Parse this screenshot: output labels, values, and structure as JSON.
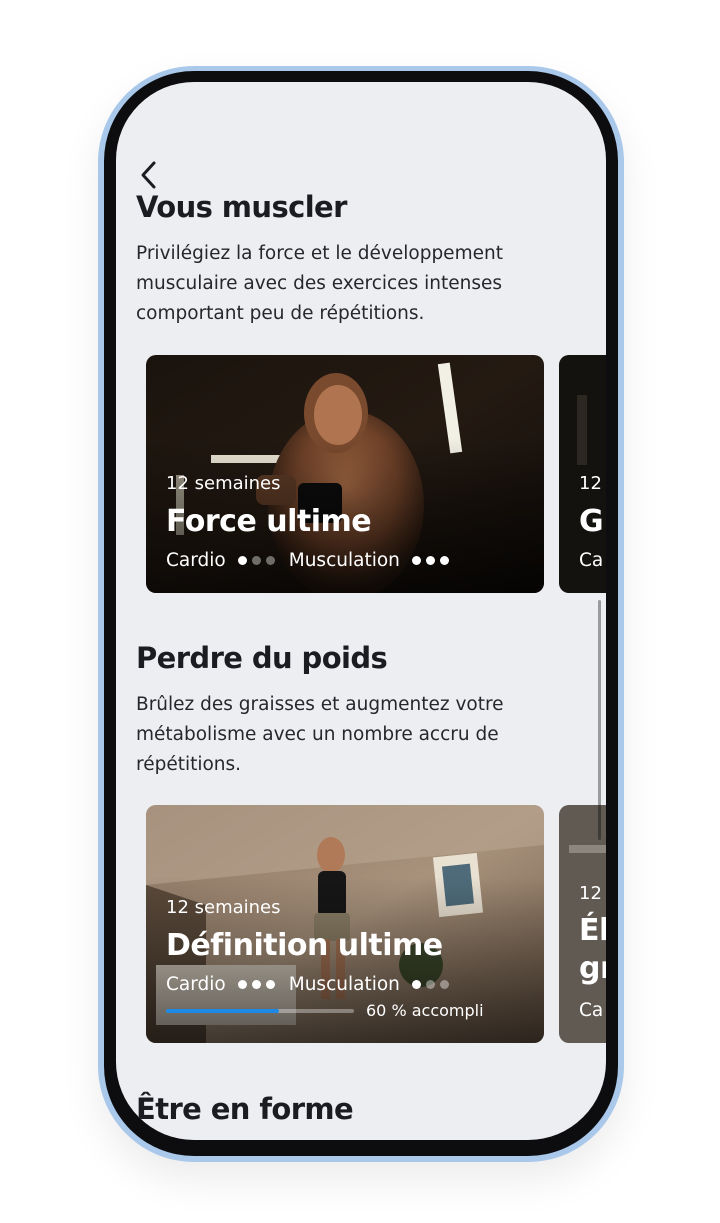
{
  "header": {
    "back_label": "Retour"
  },
  "sections": [
    {
      "title": "Vous muscler",
      "description": "Privilégiez la force et le développement musculaire avec des exercices intenses comportant peu de répétitions.",
      "cards": [
        {
          "duration": "12 semaines",
          "title": "Force ultime",
          "cardio_label": "Cardio",
          "cardio_level": 1,
          "strength_label": "Musculation",
          "strength_level": 3
        },
        {
          "duration": "12",
          "title": "G",
          "cardio_label": "Ca"
        }
      ]
    },
    {
      "title": "Perdre du poids",
      "description": "Brûlez des graisses et augmentez votre métabolisme avec un nombre accru de répétitions.",
      "cards": [
        {
          "duration": "12 semaines",
          "title": "Définition ultime",
          "cardio_label": "Cardio",
          "cardio_level": 3,
          "strength_label": "Musculation",
          "strength_level": 1,
          "progress_fraction": 0.6,
          "progress_label": "60 % accompli"
        },
        {
          "duration": "12",
          "title_line1": "Él",
          "title_line2": "gr",
          "cardio_label": "Ca"
        }
      ]
    },
    {
      "title": "Être en forme"
    }
  ],
  "colors": {
    "screen_background": "#eceef1",
    "frame_accent": "#a9c8ea",
    "progress_fill": "#1e88e5",
    "text_primary": "#1b1c21"
  },
  "icons": {
    "back": "chevron-left-icon",
    "level_dot": "dot"
  }
}
